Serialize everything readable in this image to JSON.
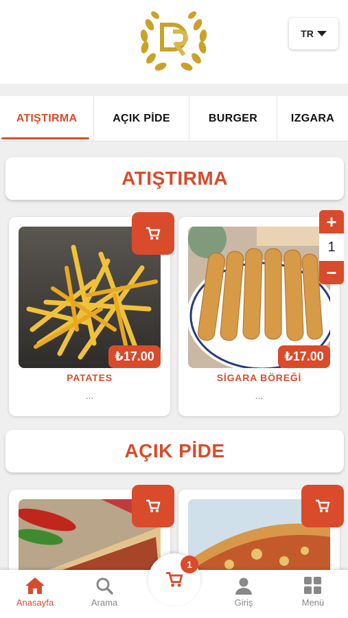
{
  "header": {
    "language": "TR"
  },
  "tabs": [
    {
      "label": "ATIŞTIRMA",
      "active": true
    },
    {
      "label": "AÇIK PİDE",
      "active": false
    },
    {
      "label": "BURGER",
      "active": false
    },
    {
      "label": "IZGARA",
      "active": false
    }
  ],
  "sections": [
    {
      "title": "ATIŞTIRMA",
      "products": [
        {
          "name": "PATATES",
          "price": "₺17.00",
          "description": "..."
        },
        {
          "name": "SİGARA BÖREĞİ",
          "price": "₺17.00",
          "description": "...",
          "quantity": "1"
        }
      ]
    },
    {
      "title": "AÇIK PİDE"
    }
  ],
  "cart": {
    "count": "1"
  },
  "bottom_nav": [
    {
      "label": "Anasayfa",
      "icon": "home-icon",
      "active": true
    },
    {
      "label": "Arama",
      "icon": "search-icon",
      "active": false
    },
    {
      "label": "Giriş",
      "icon": "user-icon",
      "active": false
    },
    {
      "label": "Menü",
      "icon": "grid-icon",
      "active": false
    }
  ],
  "colors": {
    "accent": "#d94b2b",
    "gold": "#c9a227"
  }
}
